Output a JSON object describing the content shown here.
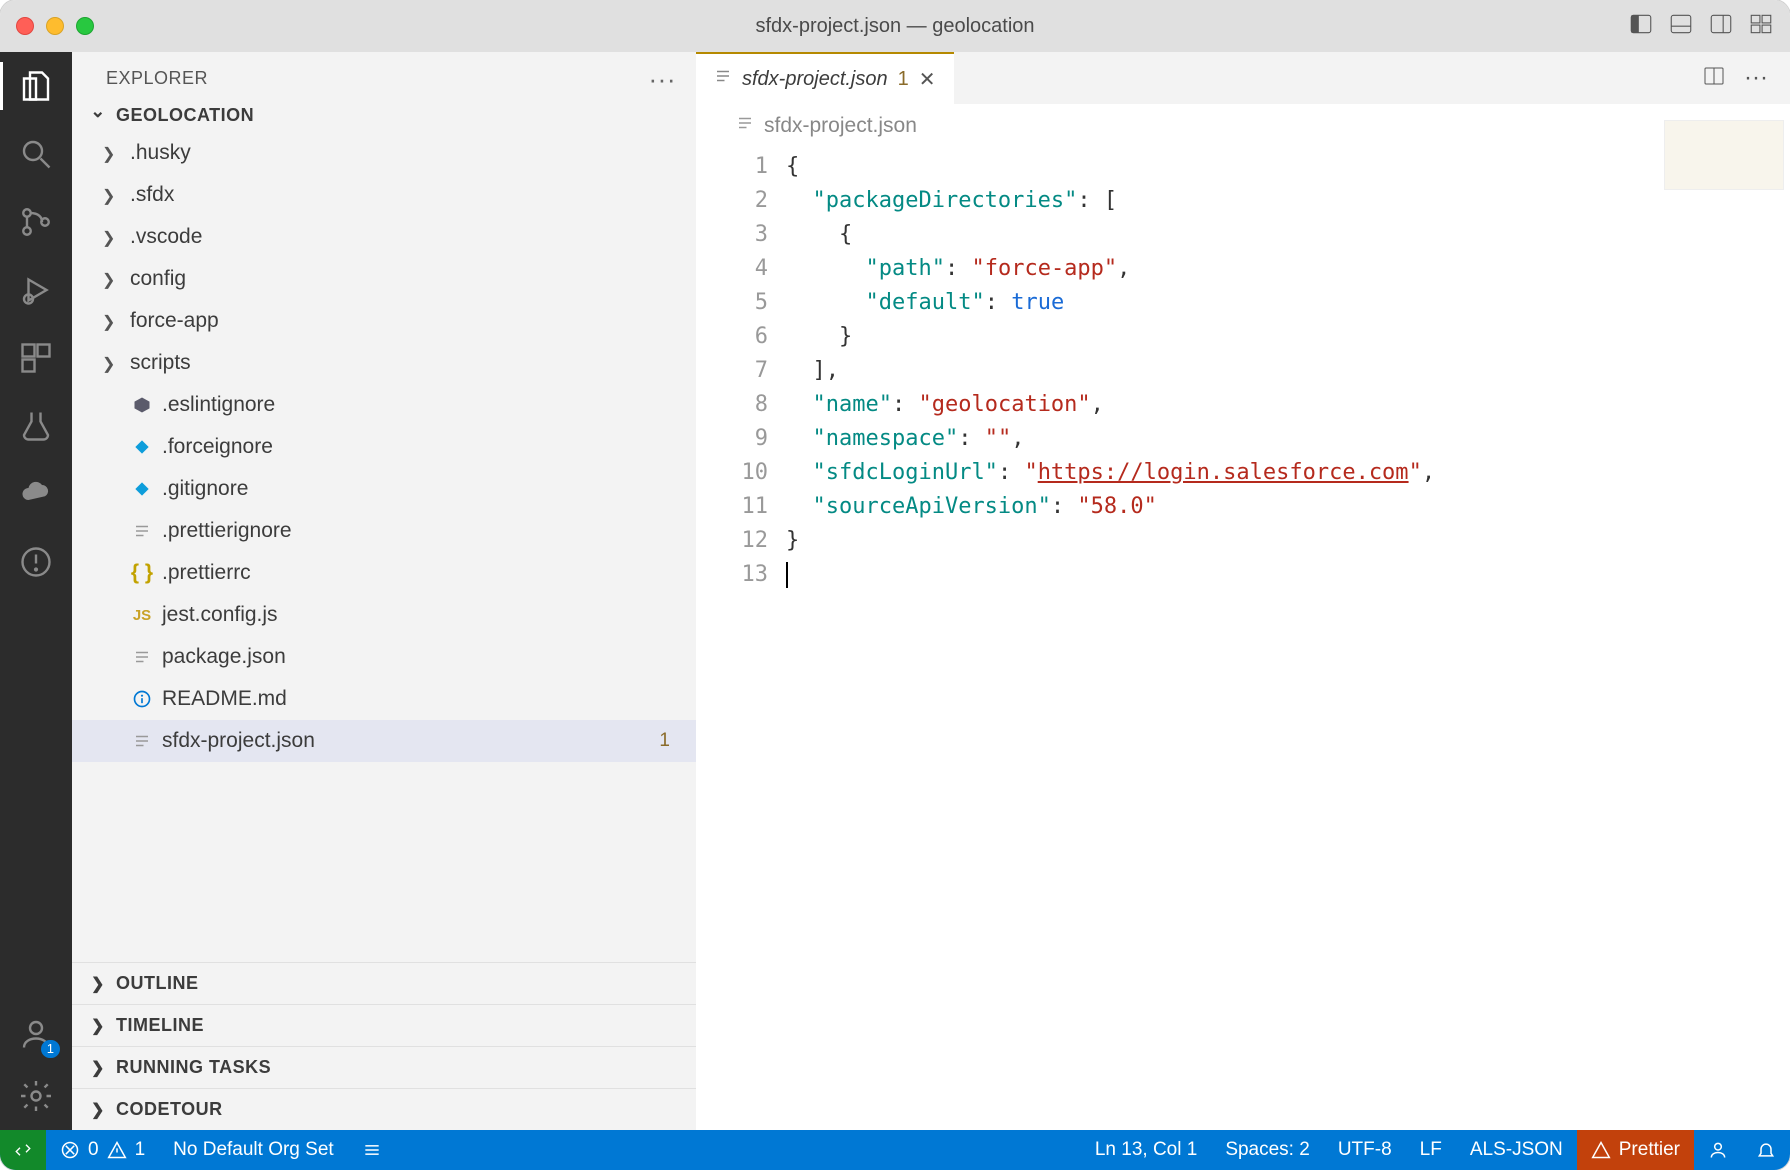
{
  "window": {
    "title": "sfdx-project.json — geolocation"
  },
  "sidebar": {
    "header": "EXPLORER",
    "project": "GEOLOCATION",
    "tree": [
      {
        "label": ".husky",
        "kind": "folder"
      },
      {
        "label": ".sfdx",
        "kind": "folder"
      },
      {
        "label": ".vscode",
        "kind": "folder"
      },
      {
        "label": "config",
        "kind": "folder"
      },
      {
        "label": "force-app",
        "kind": "folder"
      },
      {
        "label": "scripts",
        "kind": "folder"
      },
      {
        "label": ".eslintignore",
        "kind": "file",
        "icon": "eslint"
      },
      {
        "label": ".forceignore",
        "kind": "file",
        "icon": "salesforce"
      },
      {
        "label": ".gitignore",
        "kind": "file",
        "icon": "salesforce"
      },
      {
        "label": ".prettierignore",
        "kind": "file",
        "icon": "file"
      },
      {
        "label": ".prettierrc",
        "kind": "file",
        "icon": "braces"
      },
      {
        "label": "jest.config.js",
        "kind": "file",
        "icon": "js"
      },
      {
        "label": "package.json",
        "kind": "file",
        "icon": "file"
      },
      {
        "label": "README.md",
        "kind": "file",
        "icon": "info"
      },
      {
        "label": "sfdx-project.json",
        "kind": "file",
        "icon": "file",
        "selected": true,
        "badge": "1"
      }
    ],
    "sections": [
      "OUTLINE",
      "TIMELINE",
      "RUNNING TASKS",
      "CODETOUR"
    ]
  },
  "activitybar": {
    "badge": "1"
  },
  "editor": {
    "tab": {
      "label": "sfdx-project.json",
      "badge": "1"
    },
    "breadcrumb": "sfdx-project.json",
    "lines": 13,
    "content": {
      "packageDirectories": [
        {
          "path": "force-app",
          "default": true
        }
      ],
      "name": "geolocation",
      "namespace": "",
      "sfdcLoginUrl": "https://login.salesforce.com",
      "sourceApiVersion": "58.0"
    },
    "tokens": {
      "k_pd": "\"packageDirectories\"",
      "k_path": "\"path\"",
      "v_path": "\"force-app\"",
      "k_def": "\"default\"",
      "v_def": "true",
      "k_name": "\"name\"",
      "v_name": "\"geolocation\"",
      "k_ns": "\"namespace\"",
      "v_ns": "\"\"",
      "k_url": "\"sfdcLoginUrl\"",
      "v_url_open": "\"",
      "v_url_link": "https://login.salesforce.com",
      "v_url_close": "\"",
      "k_ver": "\"sourceApiVersion\"",
      "v_ver": "\"58.0\""
    }
  },
  "statusbar": {
    "errors": "0",
    "warnings": "1",
    "org": "No Default Org Set",
    "lncol": "Ln 13, Col 1",
    "spaces": "Spaces: 2",
    "encoding": "UTF-8",
    "eol": "LF",
    "lang": "ALS-JSON",
    "prettier": "Prettier"
  }
}
